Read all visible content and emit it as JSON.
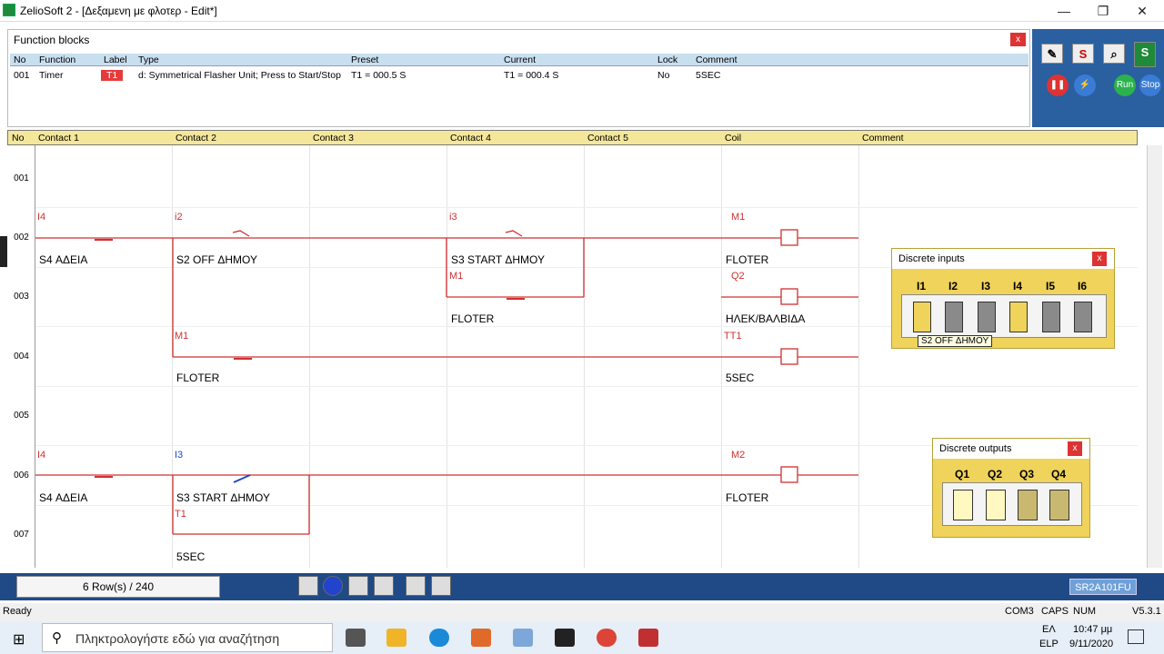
{
  "window": {
    "title": "ZelioSoft 2 - [Δεξαμενη με φλοτερ - Edit*]",
    "min": "—",
    "max": "❐",
    "close": "✕"
  },
  "function_blocks": {
    "title": "Function blocks",
    "close": "x",
    "headers": [
      "No",
      "Function",
      "Label",
      "Type",
      "Preset",
      "Current",
      "Lock",
      "Comment"
    ],
    "row": {
      "no": "001",
      "function": "Timer",
      "label": "T1",
      "type": "d: Symmetrical Flasher Unit; Press to Start/Stop",
      "preset": "T1 = 000.5 S",
      "current": "T1 = 000.4 S",
      "lock": "No",
      "comment": "5SEC"
    }
  },
  "toolbar": {
    "s": "S",
    "run": "Run",
    "stop": "Stop"
  },
  "ladder": {
    "headers": [
      "No",
      "Contact 1",
      "Contact 2",
      "Contact 3",
      "Contact 4",
      "Contact 5",
      "Coil",
      "Comment"
    ],
    "rows": [
      "001",
      "002",
      "003",
      "004",
      "005",
      "006",
      "007"
    ],
    "labels": {
      "r2c1": "I4",
      "r2c1n": "S4 ΑΔΕΙΑ",
      "r2c2": "i2",
      "r2c2n": "S2 OFF ΔΗΜΟΥ",
      "r2c4": "i3",
      "r2c4n": "S3 START ΔΗΜΟΥ",
      "r2coil": "M1",
      "r2coiln": "FLOTER",
      "r3c4": "M1",
      "r3c4n": "FLOTER",
      "r3coil": "Q2",
      "r3coiln": "ΗΛΕΚ/ΒΑΛΒΙΔΑ",
      "r4c2": "M1",
      "r4c2n": "FLOTER",
      "r4coil": "TT1",
      "r4coiln": "5SEC",
      "r6c1": "I4",
      "r6c1n": "S4 ΑΔΕΙΑ",
      "r6c2": "I3",
      "r6c2n": "S3 START ΔΗΜΟΥ",
      "r6coil": "M2",
      "r6coiln": "FLOTER",
      "r7c2": "T1",
      "r7c2n": "5SEC"
    }
  },
  "status": {
    "rows": "6 Row(s) / 240",
    "model": "SR2A101FU"
  },
  "discrete_inputs": {
    "title": "Discrete inputs",
    "close": "x",
    "labels": [
      "I1",
      "I2",
      "I3",
      "I4",
      "I5",
      "I6"
    ],
    "on": [
      true,
      false,
      false,
      true,
      false,
      false
    ],
    "tooltip": "S2 OFF ΔΗΜΟΥ"
  },
  "discrete_outputs": {
    "title": "Discrete outputs",
    "close": "x",
    "labels": [
      "Q1",
      "Q2",
      "Q3",
      "Q4"
    ],
    "on": [
      true,
      true,
      false,
      false
    ]
  },
  "statusline": {
    "ready": "Ready",
    "com": "COM3",
    "caps": "CAPS",
    "num": "NUM",
    "ver": "V5.3.1"
  },
  "taskbar": {
    "search": "Πληκτρολογήστε εδώ για αναζήτηση",
    "lang1": "ΕΛ",
    "lang2": "ELP",
    "time": "10:47 μμ",
    "date": "9/11/2020"
  },
  "colors": {
    "rung": "#d03030",
    "accent": "#1f4a86"
  }
}
